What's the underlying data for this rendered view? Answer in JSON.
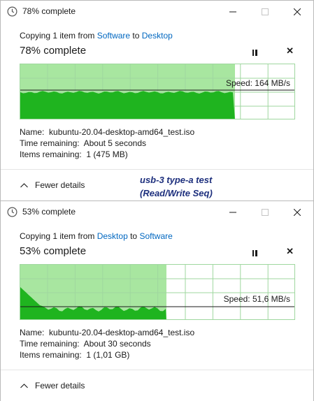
{
  "dialogs": [
    {
      "window_title": "78% complete",
      "copy_prefix": "Copying 1 item from ",
      "source": "Software",
      "to_word": " to ",
      "destination": "Desktop",
      "heading": "78% complete",
      "progress_fraction": 0.78,
      "speed": "Speed: 164 MB/s",
      "name_label": "Name:",
      "name_value": "kubuntu-20.04-desktop-amd64_test.iso",
      "time_label": "Time remaining:",
      "time_value": "About 5 seconds",
      "items_label": "Items remaining:",
      "items_value": "1 (475 MB)",
      "fewer_details": "Fewer details"
    },
    {
      "window_title": "53% complete",
      "copy_prefix": "Copying 1 item from ",
      "source": "Desktop",
      "to_word": " to ",
      "destination": "Software",
      "heading": "53% complete",
      "progress_fraction": 0.53,
      "speed": "Speed: 51,6 MB/s",
      "name_label": "Name:",
      "name_value": "kubuntu-20.04-desktop-amd64_test.iso",
      "time_label": "Time remaining:",
      "time_value": "About 30 seconds",
      "items_label": "Items remaining:",
      "items_value": "1 (1,01 GB)",
      "fewer_details": "Fewer details"
    }
  ],
  "annotation": {
    "line1": "usb-3 type-a  test",
    "line2": "(Read/Write Seq)"
  },
  "colors": {
    "progress_light": "#a8e6a0",
    "transfer_fill": "#1fb41f",
    "grid_line": "#9fd79f",
    "link": "#0067c0",
    "annotation": "#1d2f7d"
  },
  "icons": {
    "window": "clock-icon",
    "pause": "pause-icon",
    "stop": "close-icon",
    "collapse": "chevron-up-icon"
  }
}
